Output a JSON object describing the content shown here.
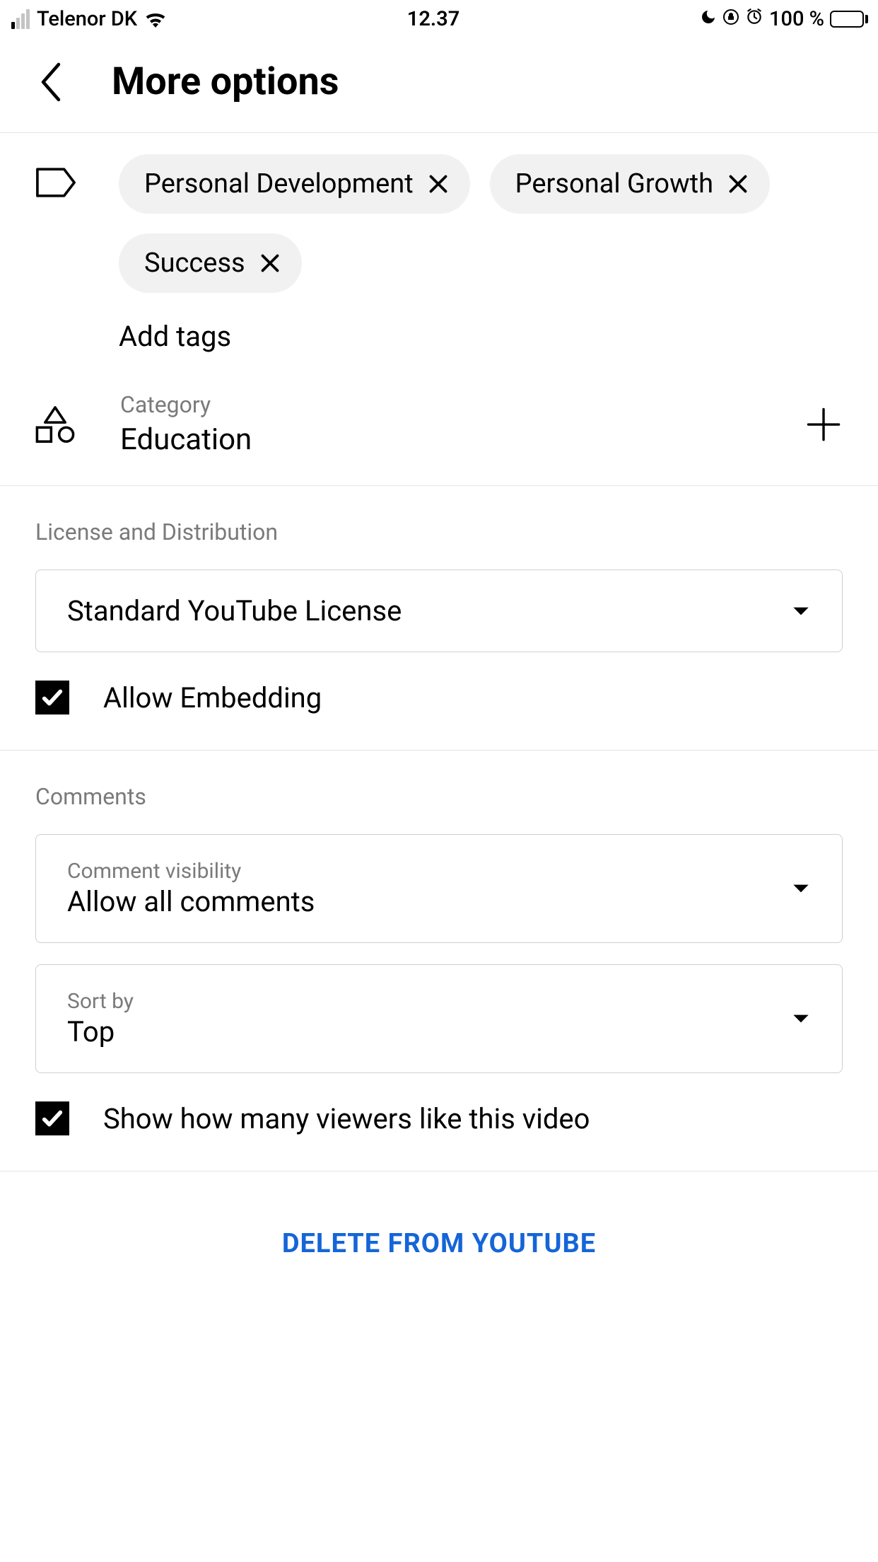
{
  "status_bar": {
    "carrier": "Telenor DK",
    "time": "12.37",
    "battery_text": "100 %"
  },
  "header": {
    "title": "More options"
  },
  "tags": {
    "items": [
      "Personal Development",
      "Personal Growth",
      "Success"
    ],
    "add_label": "Add tags"
  },
  "category": {
    "label": "Category",
    "value": "Education"
  },
  "license": {
    "section_title": "License and Distribution",
    "select_value": "Standard YouTube License",
    "embedding_label": "Allow Embedding",
    "embedding_checked": true
  },
  "comments": {
    "section_title": "Comments",
    "visibility_label": "Comment visibility",
    "visibility_value": "Allow all comments",
    "sort_label": "Sort by",
    "sort_value": "Top",
    "likes_label": "Show how many viewers like this video",
    "likes_checked": true
  },
  "delete": {
    "label": "DELETE FROM YOUTUBE"
  }
}
